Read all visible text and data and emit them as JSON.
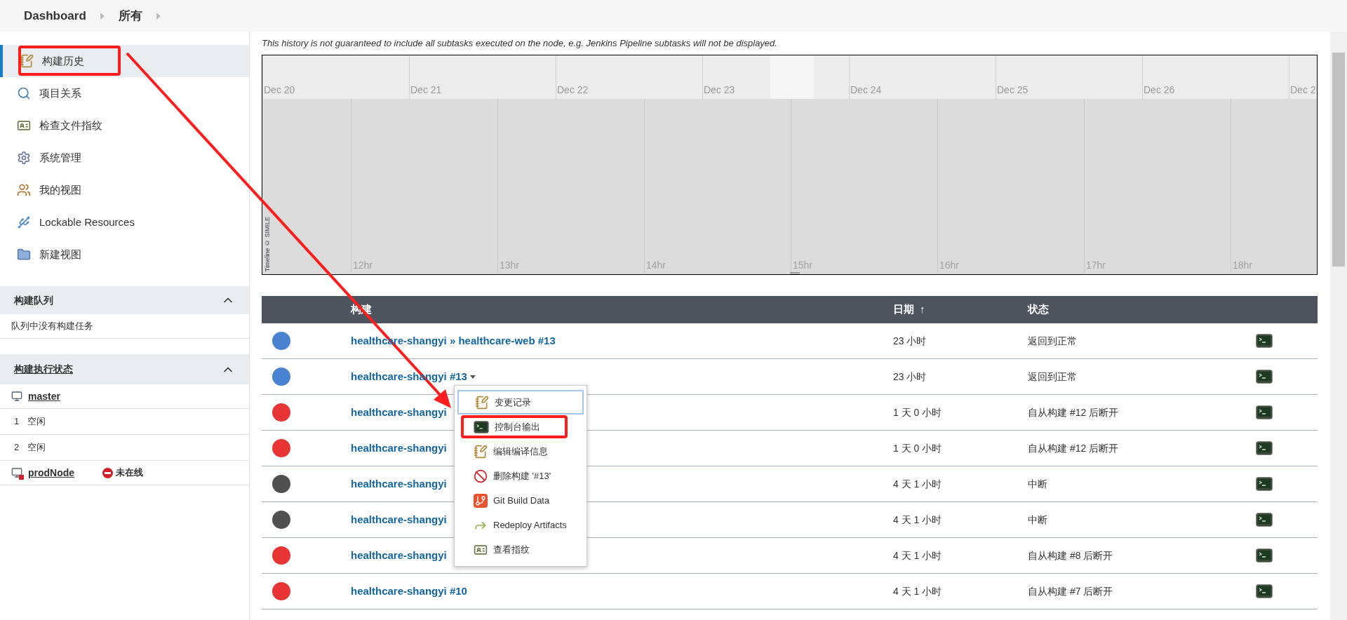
{
  "breadcrumb": [
    {
      "label": "Dashboard"
    },
    {
      "label": "所有"
    }
  ],
  "sidebar": {
    "items": [
      {
        "label": "构建历史",
        "selected": true,
        "annotated": true
      },
      {
        "label": "项目关系",
        "selected": false,
        "annotated": false
      },
      {
        "label": "检查文件指纹",
        "selected": false,
        "annotated": false
      },
      {
        "label": "系统管理",
        "selected": false,
        "annotated": false
      },
      {
        "label": "我的视图",
        "selected": false,
        "annotated": false
      },
      {
        "label": "Lockable Resources",
        "selected": false,
        "annotated": false
      },
      {
        "label": "新建视图",
        "selected": false,
        "annotated": false
      }
    ],
    "build_queue": {
      "title": "构建队列",
      "expanded": true,
      "empty_text": "队列中没有构建任务"
    },
    "executors": {
      "title": "构建执行状态",
      "expanded": true,
      "nodes": [
        {
          "name": "master",
          "online": true,
          "slots": [
            {
              "number": "1",
              "state": "空闲"
            },
            {
              "number": "2",
              "state": "空闲"
            }
          ]
        },
        {
          "name": "prodNode",
          "online": false,
          "status": "未在线"
        }
      ]
    }
  },
  "note": "This history is not guaranteed to include all subtasks executed on the node, e.g. Jenkins Pipeline subtasks will not be displayed.",
  "timeline": {
    "date_labels": [
      "Dec 20",
      "Dec 21",
      "Dec 22",
      "Dec 23",
      "Dec 24",
      "Dec 25",
      "Dec 26",
      "Dec 2"
    ],
    "hour_labels": [
      "12hr",
      "13hr",
      "14hr",
      "15hr",
      "16hr",
      "17hr",
      "18hr"
    ],
    "credit": "Timeline © SIMILE"
  },
  "table": {
    "columns": [
      {
        "label": "构建"
      },
      {
        "label": "日期",
        "sort": "↑"
      },
      {
        "label": "状态"
      }
    ],
    "rows": [
      {
        "color": "#4a82d2",
        "build": "healthcare-shangyi » healthcare-web #13",
        "dropdown": false,
        "date": "23 小时",
        "status": "返回到正常"
      },
      {
        "color": "#4a82d2",
        "build": "healthcare-shangyi #13",
        "dropdown": true,
        "date": "23 小时",
        "status": "返回到正常"
      },
      {
        "color": "#e83434",
        "build": "healthcare-shangyi",
        "dropdown": false,
        "date": "1 天 0 小时",
        "status": "自从构建 #12 后断开"
      },
      {
        "color": "#e83434",
        "build": "healthcare-shangyi",
        "dropdown": false,
        "date": "1 天 0 小时",
        "status": "自从构建 #12 后断开"
      },
      {
        "color": "#505050",
        "build": "healthcare-shangyi",
        "dropdown": false,
        "date": "4 天 1 小时",
        "status": "中断"
      },
      {
        "color": "#505050",
        "build": "healthcare-shangyi",
        "dropdown": false,
        "date": "4 天 1 小时",
        "status": "中断"
      },
      {
        "color": "#e83434",
        "build": "healthcare-shangyi",
        "dropdown": false,
        "date": "4 天 1 小时",
        "status": "自从构建 #8 后断开"
      },
      {
        "color": "#e83434",
        "build": "healthcare-shangyi #10",
        "dropdown": false,
        "date": "4 天 1 小时",
        "status": "自从构建 #7 后断开"
      }
    ]
  },
  "context_menu": {
    "items": [
      {
        "label": "变更记录",
        "selected": true,
        "annotated": false
      },
      {
        "label": "控制台输出",
        "selected": false,
        "annotated": true
      },
      {
        "label": "编辑编译信息",
        "selected": false,
        "annotated": false
      },
      {
        "label": "删除构建 '#13'",
        "selected": false,
        "annotated": false
      },
      {
        "label": "Git Build Data",
        "selected": false,
        "annotated": false
      },
      {
        "label": "Redeploy Artifacts",
        "selected": false,
        "annotated": false
      },
      {
        "label": "查看指纹",
        "selected": false,
        "annotated": false
      }
    ]
  }
}
